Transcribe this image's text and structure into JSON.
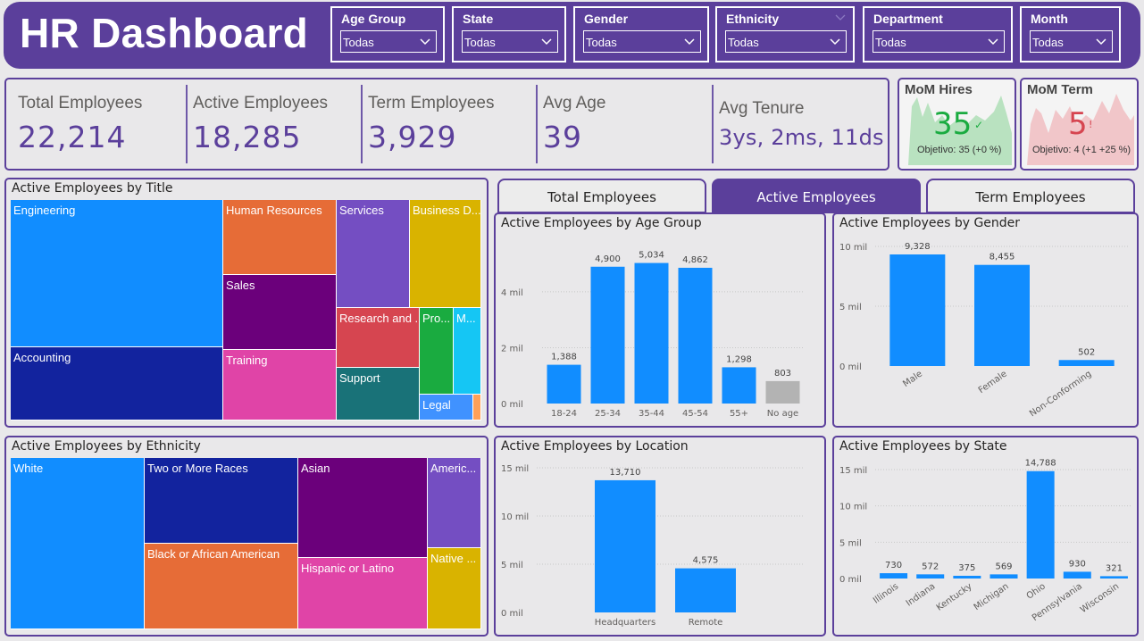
{
  "header": {
    "title": "HR Dashboard"
  },
  "slicers": [
    {
      "label": "Age Group",
      "value": "Todas"
    },
    {
      "label": "State",
      "value": "Todas"
    },
    {
      "label": "Gender",
      "value": "Todas"
    },
    {
      "label": "Ethnicity",
      "value": "Todas"
    },
    {
      "label": "Department",
      "value": "Todas"
    },
    {
      "label": "Month",
      "value": "Todas"
    }
  ],
  "kpis": [
    {
      "label": "Total Employees",
      "value": "22,214"
    },
    {
      "label": "Active Employees",
      "value": "18,285"
    },
    {
      "label": "Term Employees",
      "value": "3,929"
    },
    {
      "label": "Avg Age",
      "value": "39"
    },
    {
      "label": "Avg Tenure",
      "value": "3ys, 2ms, 11ds"
    }
  ],
  "mom_hires": {
    "title": "MoM Hires",
    "value": "35",
    "status_glyph": "✓",
    "goal": "Objetivo: 35 (+0 %)",
    "color": "#1aab40"
  },
  "mom_term": {
    "title": "MoM Term",
    "value": "5",
    "status_glyph": "!",
    "goal": "Objetivo: 4 (+1 +25 %)",
    "color": "#d64550"
  },
  "tabs": [
    {
      "label": "Total Employees",
      "active": false
    },
    {
      "label": "Active Employees",
      "active": true
    },
    {
      "label": "Term Employees",
      "active": false
    }
  ],
  "title_treemap": {
    "title": "Active Employees by Title",
    "items": [
      {
        "label": "Engineering",
        "color": "#118dff"
      },
      {
        "label": "Accounting",
        "color": "#12239e"
      },
      {
        "label": "Human Resources",
        "color": "#e66c37"
      },
      {
        "label": "Sales",
        "color": "#6b007b"
      },
      {
        "label": "Training",
        "color": "#e044a7"
      },
      {
        "label": "Services",
        "color": "#744ec2"
      },
      {
        "label": "Business D...",
        "color": "#d9b300"
      },
      {
        "label": "Research and ...",
        "color": "#d64550"
      },
      {
        "label": "Pro...",
        "color": "#1aab40"
      },
      {
        "label": "M...",
        "color": "#15c6f4"
      },
      {
        "label": "Support",
        "color": "#197278"
      },
      {
        "label": "Legal",
        "color": "#4092ff"
      },
      {
        "label": "",
        "color": "#ffa058"
      }
    ]
  },
  "ethnicity_treemap": {
    "title": "Active Employees by Ethnicity",
    "items": [
      {
        "label": "White",
        "color": "#118dff"
      },
      {
        "label": "Two or More Races",
        "color": "#12239e"
      },
      {
        "label": "Black or African American",
        "color": "#e66c37"
      },
      {
        "label": "Asian",
        "color": "#6b007b"
      },
      {
        "label": "Hispanic or Latino",
        "color": "#e044a7"
      },
      {
        "label": "Americ...",
        "color": "#744ec2"
      },
      {
        "label": "Native ...",
        "color": "#d9b300"
      }
    ]
  },
  "chart_data": [
    {
      "type": "bar",
      "title": "Active Employees by Age Group",
      "categories": [
        "18-24",
        "25-34",
        "35-44",
        "45-54",
        "55+",
        "No age"
      ],
      "values": [
        1388,
        4900,
        5034,
        4862,
        1298,
        803
      ],
      "value_labels": [
        "1,388",
        "4,900",
        "5,034",
        "4,862",
        "1,298",
        "803"
      ],
      "colors": [
        "#118dff",
        "#118dff",
        "#118dff",
        "#118dff",
        "#118dff",
        "#b3b3b3"
      ],
      "yticks": [
        0,
        2000,
        4000
      ],
      "ytick_labels": [
        "0 mil",
        "2 mil",
        "4 mil"
      ],
      "ylim": [
        0,
        5500
      ],
      "grid": true
    },
    {
      "type": "bar",
      "title": "Active Employees by Gender",
      "categories": [
        "Male",
        "Female",
        "Non-Conforming"
      ],
      "values": [
        9328,
        8455,
        502
      ],
      "value_labels": [
        "9,328",
        "8,455",
        "502"
      ],
      "yticks": [
        0,
        5000,
        10000
      ],
      "ytick_labels": [
        "0 mil",
        "5 mil",
        "10 mil"
      ],
      "ylim": [
        0,
        10000
      ],
      "grid": true
    },
    {
      "type": "bar",
      "title": "Active Employees by Location",
      "categories": [
        "Headquarters",
        "Remote"
      ],
      "values": [
        13710,
        4575
      ],
      "value_labels": [
        "13,710",
        "4,575"
      ],
      "yticks": [
        0,
        5000,
        10000,
        15000
      ],
      "ytick_labels": [
        "0 mil",
        "5 mil",
        "10 mil",
        "15 mil"
      ],
      "ylim": [
        0,
        15000
      ],
      "grid": true
    },
    {
      "type": "bar",
      "title": "Active Employees by State",
      "categories": [
        "Illinois",
        "Indiana",
        "Kentucky",
        "Michigan",
        "Ohio",
        "Pennsylvania",
        "Wisconsin"
      ],
      "values": [
        730,
        572,
        375,
        569,
        14788,
        930,
        321
      ],
      "value_labels": [
        "730",
        "572",
        "375",
        "569",
        "14,788",
        "930",
        "321"
      ],
      "yticks": [
        0,
        5000,
        10000,
        15000
      ],
      "ytick_labels": [
        "0 mil",
        "5 mil",
        "10 mil",
        "15 mil"
      ],
      "ylim": [
        0,
        15000
      ],
      "grid": true
    }
  ],
  "colors": {
    "brand_purple": "#5b3f9b",
    "bar_blue": "#118dff"
  }
}
